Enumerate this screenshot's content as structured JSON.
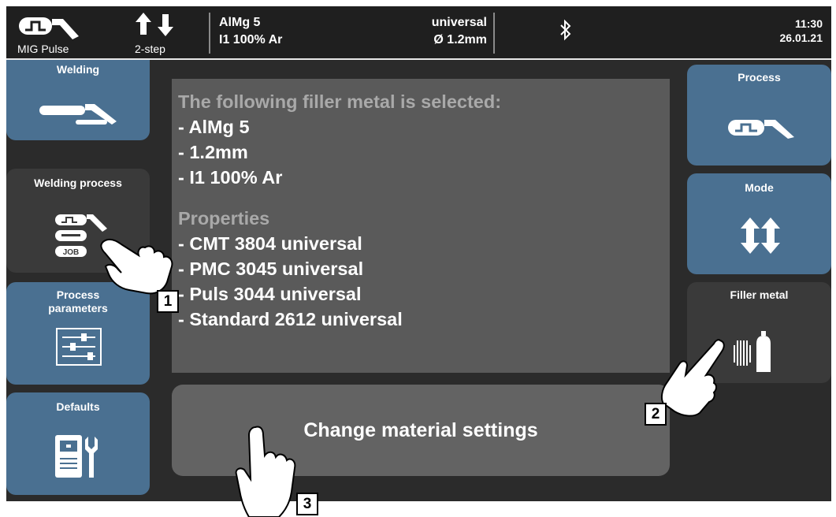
{
  "status_bar": {
    "process_label": "MIG Pulse",
    "mode_label": "2-step",
    "material": "AlMg 5",
    "gas": "I1 100% Ar",
    "characteristic": "universal",
    "diameter": "Ø 1.2mm",
    "bluetooth_icon": "bluetooth-icon",
    "time": "11:30",
    "date": "26.01.21"
  },
  "left_nav": [
    {
      "label": "Welding",
      "icon": "welding-torch-icon",
      "selected": false
    },
    {
      "label": "Welding process",
      "icon": "welding-process-icon",
      "selected": true
    },
    {
      "label": "Process\nparameters",
      "icon": "sliders-icon",
      "selected": false
    },
    {
      "label": "Defaults",
      "icon": "defaults-icon",
      "selected": false
    }
  ],
  "info_panel": {
    "heading": "The following filler metal is selected:",
    "selected": [
      "- AlMg 5",
      "- 1.2mm",
      "- I1 100% Ar"
    ],
    "properties_heading": "Properties",
    "properties": [
      "- CMT 3804 universal",
      "- PMC 3045 universal",
      "- Puls 3044 universal",
      "- Standard 2612 universal"
    ]
  },
  "change_button": {
    "label": "Change material settings"
  },
  "right_nav": [
    {
      "label": "Process",
      "icon": "pulse-torch-icon",
      "selected": false
    },
    {
      "label": "Mode",
      "icon": "two-step-arrows-icon",
      "selected": false
    },
    {
      "label": "Filler metal",
      "icon": "wire-gas-icon",
      "selected": true
    }
  ],
  "callouts": [
    "1",
    "2",
    "3"
  ],
  "colors": {
    "button_blue": "#4a7091",
    "selected_dark": "#3a3a3a",
    "panel_gray": "#5a5a5a",
    "heading_gray": "#a9a9a9"
  }
}
